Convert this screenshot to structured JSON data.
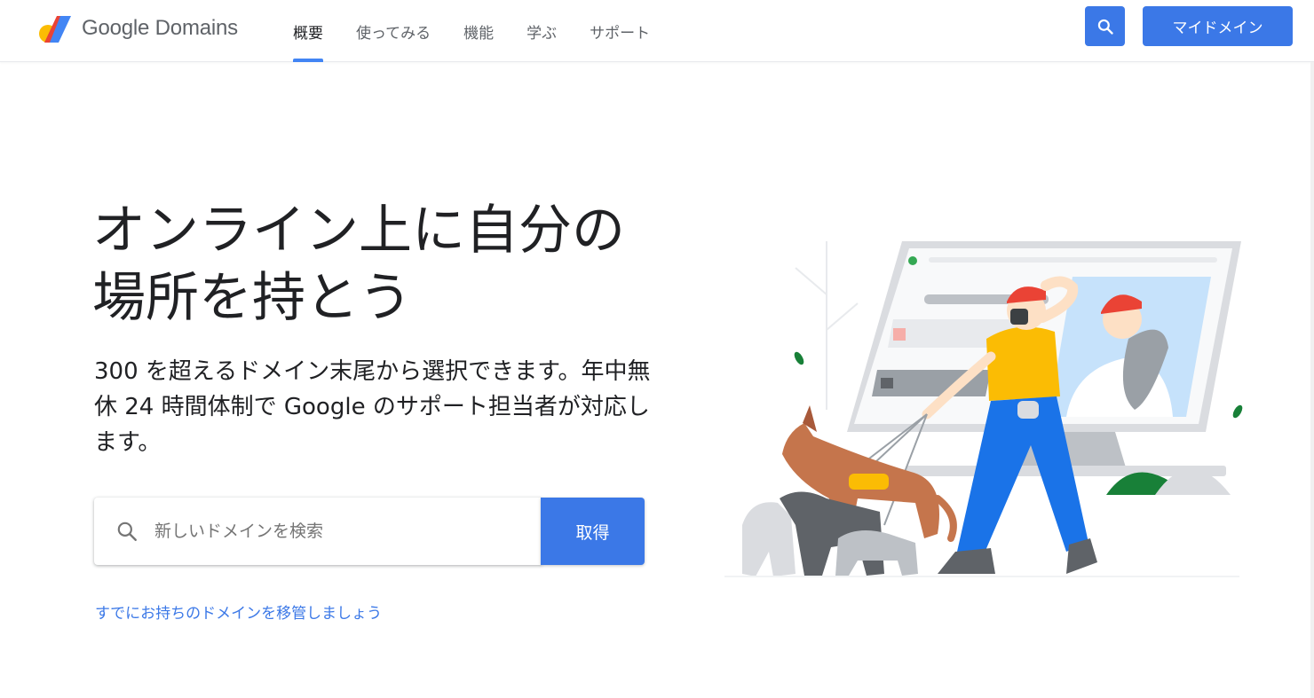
{
  "header": {
    "brand": "Google Domains",
    "nav": [
      {
        "label": "概要",
        "active": true
      },
      {
        "label": "使ってみる",
        "active": false
      },
      {
        "label": "機能",
        "active": false
      },
      {
        "label": "学ぶ",
        "active": false
      },
      {
        "label": "サポート",
        "active": false
      }
    ],
    "search_icon": "search-icon",
    "my_domains_label": "マイドメイン"
  },
  "hero": {
    "title_line1": "オンライン上に自分の",
    "title_line2": "場所を持とう",
    "subtitle": "300 を超えるドメイン末尾から選択できます。年中無休 24 時間体制で Google のサポート担当者が対応します。",
    "search_placeholder": "新しいドメインを検索",
    "get_button_label": "取得",
    "transfer_link": "すでにお持ちのドメインを移管しましょう"
  },
  "colors": {
    "accent": "#3b78e7",
    "text": "#202124",
    "muted": "#5f6368"
  }
}
